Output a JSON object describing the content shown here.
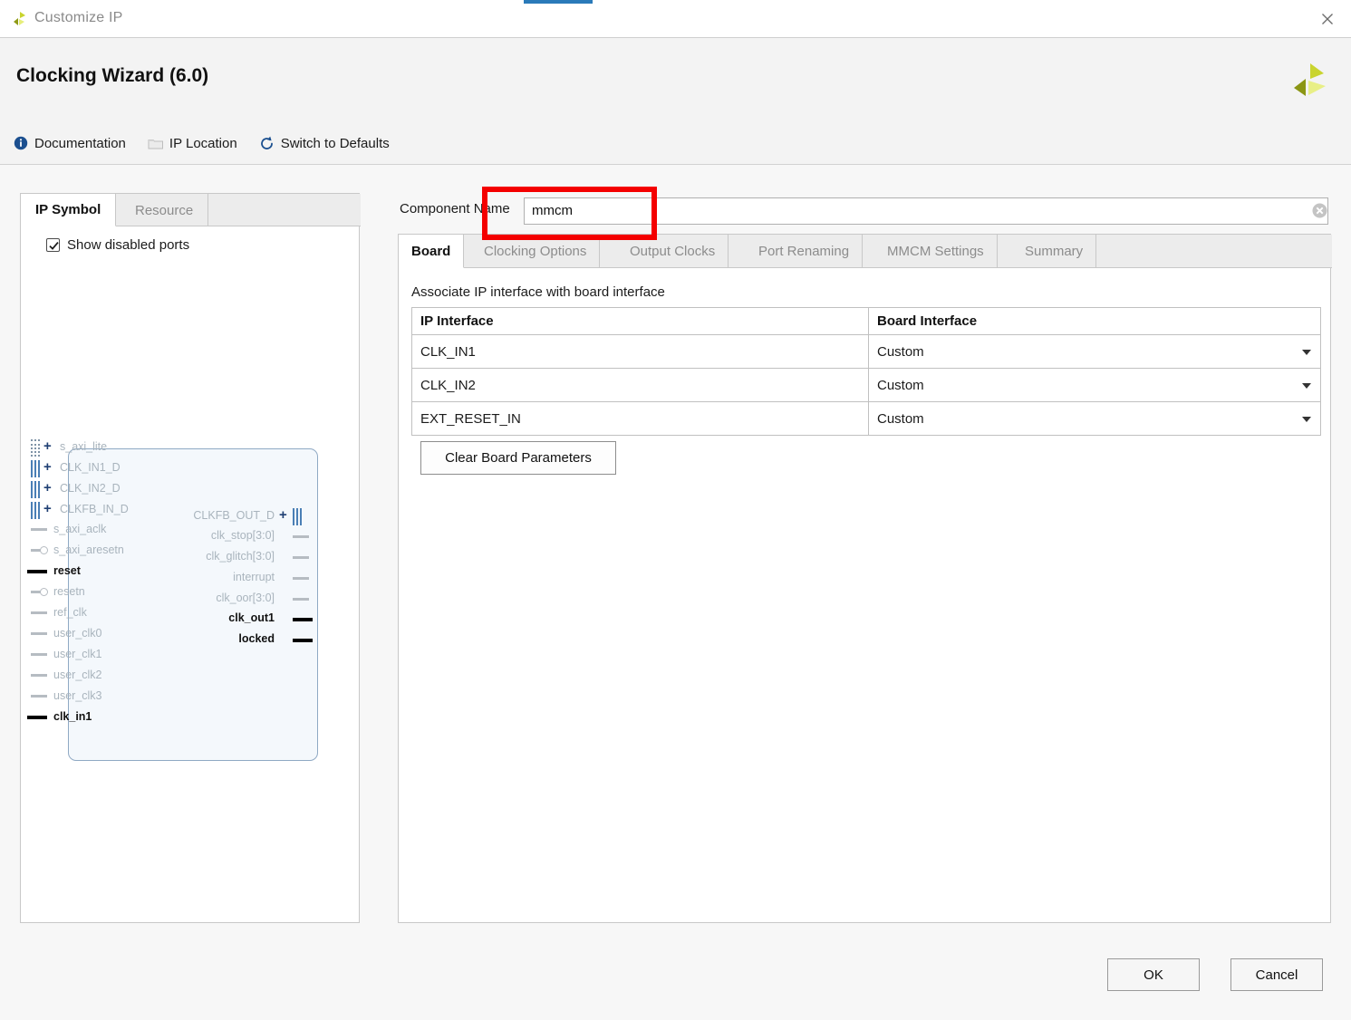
{
  "window": {
    "title": "Customize IP",
    "close_icon": "close-icon",
    "logo_icon": "xilinx-logo-icon"
  },
  "header": {
    "wizard_title": "Clocking Wizard (6.0)",
    "brand_logo": "xilinx-logo-icon",
    "toolbar": [
      {
        "label": "Documentation",
        "icon": "info-icon"
      },
      {
        "label": "IP Location",
        "icon": "folder-icon"
      },
      {
        "label": "Switch to Defaults",
        "icon": "refresh-icon"
      }
    ]
  },
  "left_panel": {
    "tabs": [
      {
        "label": "IP Symbol",
        "active": true
      },
      {
        "label": "Resource",
        "active": false
      }
    ],
    "show_disabled_ports": {
      "label": "Show disabled ports",
      "checked": true
    },
    "symbol": {
      "left_ports": [
        {
          "name": "s_axi_lite",
          "type": "bus",
          "enabled": false
        },
        {
          "name": "CLK_IN1_D",
          "type": "bus",
          "enabled": false
        },
        {
          "name": "CLK_IN2_D",
          "type": "bus",
          "enabled": false
        },
        {
          "name": "CLKFB_IN_D",
          "type": "bus",
          "enabled": false
        },
        {
          "name": "s_axi_aclk",
          "type": "signal",
          "enabled": false
        },
        {
          "name": "s_axi_aresetn",
          "type": "signal-inverted",
          "enabled": false
        },
        {
          "name": "reset",
          "type": "signal",
          "enabled": true
        },
        {
          "name": "resetn",
          "type": "signal-inverted",
          "enabled": false
        },
        {
          "name": "ref_clk",
          "type": "signal",
          "enabled": false
        },
        {
          "name": "user_clk0",
          "type": "signal",
          "enabled": false
        },
        {
          "name": "user_clk1",
          "type": "signal",
          "enabled": false
        },
        {
          "name": "user_clk2",
          "type": "signal",
          "enabled": false
        },
        {
          "name": "user_clk3",
          "type": "signal",
          "enabled": false
        },
        {
          "name": "clk_in1",
          "type": "signal",
          "enabled": true
        }
      ],
      "right_ports": [
        {
          "name": "CLKFB_OUT_D",
          "type": "bus",
          "enabled": false
        },
        {
          "name": "clk_stop[3:0]",
          "type": "signal",
          "enabled": false
        },
        {
          "name": "clk_glitch[3:0]",
          "type": "signal",
          "enabled": false
        },
        {
          "name": "interrupt",
          "type": "signal",
          "enabled": false
        },
        {
          "name": "clk_oor[3:0]",
          "type": "signal",
          "enabled": false
        },
        {
          "name": "clk_out1",
          "type": "signal",
          "enabled": true
        },
        {
          "name": "locked",
          "type": "signal",
          "enabled": true
        }
      ]
    }
  },
  "component_name": {
    "label": "Component Name",
    "value": "mmcm",
    "clear_icon": "clear-circle-icon"
  },
  "right_panel": {
    "tabs": [
      {
        "label": "Board",
        "active": true
      },
      {
        "label": "Clocking Options",
        "active": false
      },
      {
        "label": "Output Clocks",
        "active": false
      },
      {
        "label": "Port Renaming",
        "active": false
      },
      {
        "label": "MMCM Settings",
        "active": false
      },
      {
        "label": "Summary",
        "active": false
      }
    ],
    "board": {
      "description": "Associate IP interface with board interface",
      "table": {
        "headers": [
          "IP Interface",
          "Board Interface"
        ],
        "rows": [
          {
            "ip_interface": "CLK_IN1",
            "board_interface": "Custom"
          },
          {
            "ip_interface": "CLK_IN2",
            "board_interface": "Custom"
          },
          {
            "ip_interface": "EXT_RESET_IN",
            "board_interface": "Custom"
          }
        ]
      },
      "clear_button": "Clear Board Parameters"
    }
  },
  "footer": {
    "ok": "OK",
    "cancel": "Cancel"
  },
  "annotation": {
    "color": "#f40000",
    "target": "component-name-field"
  }
}
